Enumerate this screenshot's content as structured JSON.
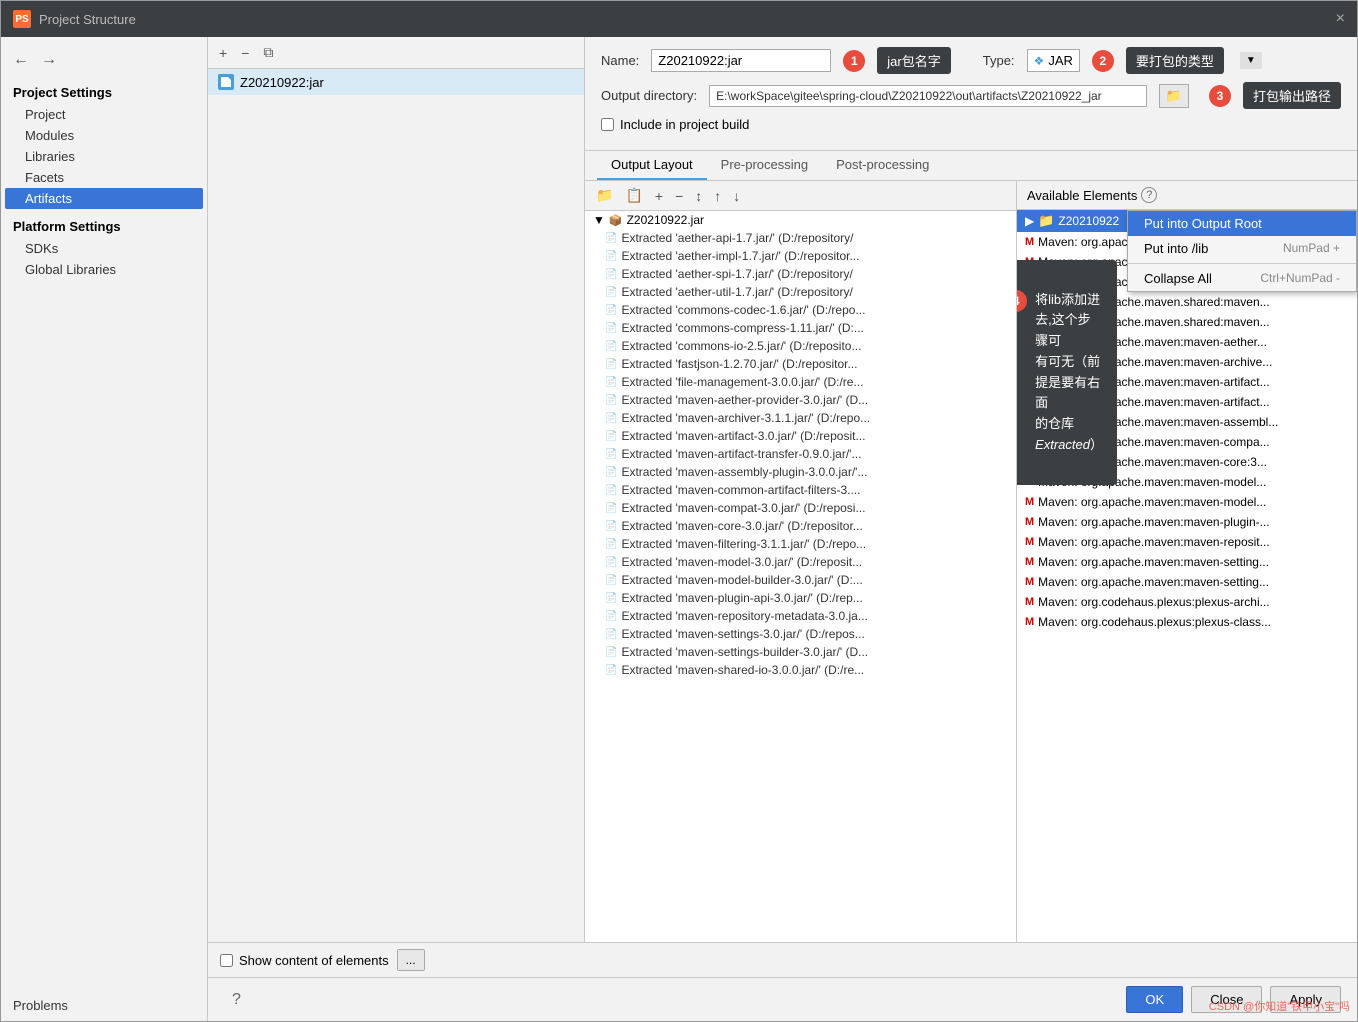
{
  "window": {
    "title": "Project Structure",
    "appIcon": "PS",
    "closeLabel": "×"
  },
  "navButtons": {
    "back": "←",
    "forward": "→"
  },
  "sidebar": {
    "addBtn": "+",
    "projectSettings": {
      "title": "Project Settings",
      "items": [
        "Project",
        "Modules",
        "Libraries",
        "Facets",
        "Artifacts"
      ]
    },
    "platformSettings": {
      "title": "Platform Settings",
      "items": [
        "SDKs",
        "Global Libraries"
      ]
    },
    "problems": "Problems"
  },
  "artifactList": {
    "toolbarBtns": [
      "+",
      "−",
      "⧉"
    ],
    "item": "Z20210922:jar"
  },
  "config": {
    "nameLabel": "Name:",
    "nameValue": "Z20210922:jar",
    "nameAnnotationNum": "1",
    "nameAnnotationText": "jar包名字",
    "typeLabel": "Type:",
    "typeIcon": "❖",
    "typeValue": "JAR",
    "typeAnnotationNum": "2",
    "typeAnnotationText": "要打包的类型",
    "outputDirLabel": "Output directory:",
    "outputDirValue": "E:\\workSpace\\gitee\\spring-cloud\\Z20210922\\out\\artifacts\\Z20210922_jar",
    "outputAnnotationNum": "3",
    "outputAnnotationText": "打包输出路径",
    "includeLabel": "Include in project build"
  },
  "tabs": [
    "Output Layout",
    "Pre-processing",
    "Post-processing"
  ],
  "activeTab": "Output Layout",
  "outputToolbar": {
    "btns": [
      "📁+",
      "⬜+",
      "+",
      "−",
      "↕",
      "↑",
      "↓"
    ]
  },
  "treeRoot": "Z20210922.jar",
  "treeItems": [
    "Extracted 'aether-api-1.7.jar/' (D:/repository/",
    "Extracted 'aether-impl-1.7.jar/' (D:/repositor...",
    "Extracted 'aether-spi-1.7.jar/' (D:/repository/",
    "Extracted 'aether-util-1.7.jar/' (D:/repository/",
    "Extracted 'commons-codec-1.6.jar/' (D:/repo...",
    "Extracted 'commons-compress-1.11.jar/' (D:...",
    "Extracted 'commons-io-2.5.jar/' (D:/reposito...",
    "Extracted 'fastjson-1.2.70.jar/' (D:/repositor...",
    "Extracted 'file-management-3.0.0.jar/' (D:/re...",
    "Extracted 'maven-aether-provider-3.0.jar/' (D...",
    "Extracted 'maven-archiver-3.1.1.jar/' (D:/repo...",
    "Extracted 'maven-artifact-3.0.jar/' (D:/reposit...",
    "Extracted 'maven-artifact-transfer-0.9.0.jar/'...",
    "Extracted 'maven-assembly-plugin-3.0.0.jar/'...",
    "Extracted 'maven-common-artifact-filters-3....",
    "Extracted 'maven-compat-3.0.jar/' (D:/reposi...",
    "Extracted 'maven-core-3.0.jar/' (D:/repositor...",
    "Extracted 'maven-filtering-3.1.1.jar/' (D:/repo...",
    "Extracted 'maven-model-3.0.jar/' (D:/reposit...",
    "Extracted 'maven-model-builder-3.0.jar/' (D:...",
    "Extracted 'maven-plugin-api-3.0.jar/' (D:/rep...",
    "Extracted 'maven-repository-metadata-3.0.ja...",
    "Extracted 'maven-settings-3.0.jar/' (D:/repos...",
    "Extracted 'maven-settings-builder-3.0.jar/' (D...",
    "Extracted 'maven-shared-io-3.0.0.jar/' (D:/re..."
  ],
  "availableElements": {
    "header": "Available Elements",
    "helpIcon": "?",
    "rootFolder": "Z20210922",
    "items": [
      "Ma...",
      "M...",
      "Ma...",
      "Ma...",
      "Ma...",
      "Ma...",
      "Ma...",
      "Ma...",
      "Ma...",
      "Ma...",
      "Ma...",
      "Ma...",
      "Ma...",
      "Ma...",
      "Ma...",
      "Ma...",
      "Ma...",
      "Ma...",
      "Ma...",
      "Ma...",
      "Ma...",
      "Ma...",
      "Ma...",
      "Ma..."
    ],
    "mavenItems": [
      "Maven: org.apache.maven.shared:file-ma...",
      "Maven: org.apache.maven.shared:maven...",
      "Maven: org.apache.maven.shared:maven...",
      "Maven: org.apache.maven.shared:maven...",
      "Maven: org.apache.maven.shared:maven...",
      "Maven: org.apache.maven:maven-aether...",
      "Maven: org.apache.maven:maven-archive...",
      "Maven: org.apache.maven:maven-artifact...",
      "Maven: org.apache.maven:maven-artifact...",
      "Maven: org.apache.maven:maven-assembl...",
      "Maven: org.apache.maven:maven-compa...",
      "Maven: org.apache.maven:maven-core:3...",
      "Maven: org.apache.maven:maven-model...",
      "Maven: org.apache.maven:maven-model...",
      "Maven: org.apache.maven:maven-plugin-...",
      "Maven: org.apache.maven:maven-reposit...",
      "Maven: org.apache.maven:maven-setting...",
      "Maven: org.apache.maven:maven-setting...",
      "Maven: org.codehaus.plexus:plexus-archi...",
      "Maven: org.codehaus.plexus:plexus-class..."
    ]
  },
  "contextMenu": {
    "items": [
      {
        "label": "Put into Output Root",
        "shortcut": "",
        "highlighted": true
      },
      {
        "label": "Put into /lib",
        "shortcut": "NumPad +",
        "highlighted": false
      },
      {
        "separator": true
      },
      {
        "label": "Collapse All",
        "shortcut": "Ctrl+NumPad -",
        "highlighted": false
      }
    ]
  },
  "annotation4": {
    "num": "4",
    "text": "将lib添加进去,这个步骤可\n有可无（前提是要有右面\n的仓库Extracted）"
  },
  "bottomBar": {
    "showContentLabel": "Show content of elements",
    "moreBtn": "..."
  },
  "dialogButtons": {
    "help": "?",
    "ok": "OK",
    "close": "Close",
    "apply": "Apply"
  },
  "watermark": "CSDN @你知道\"铁甲小宝\"吗"
}
